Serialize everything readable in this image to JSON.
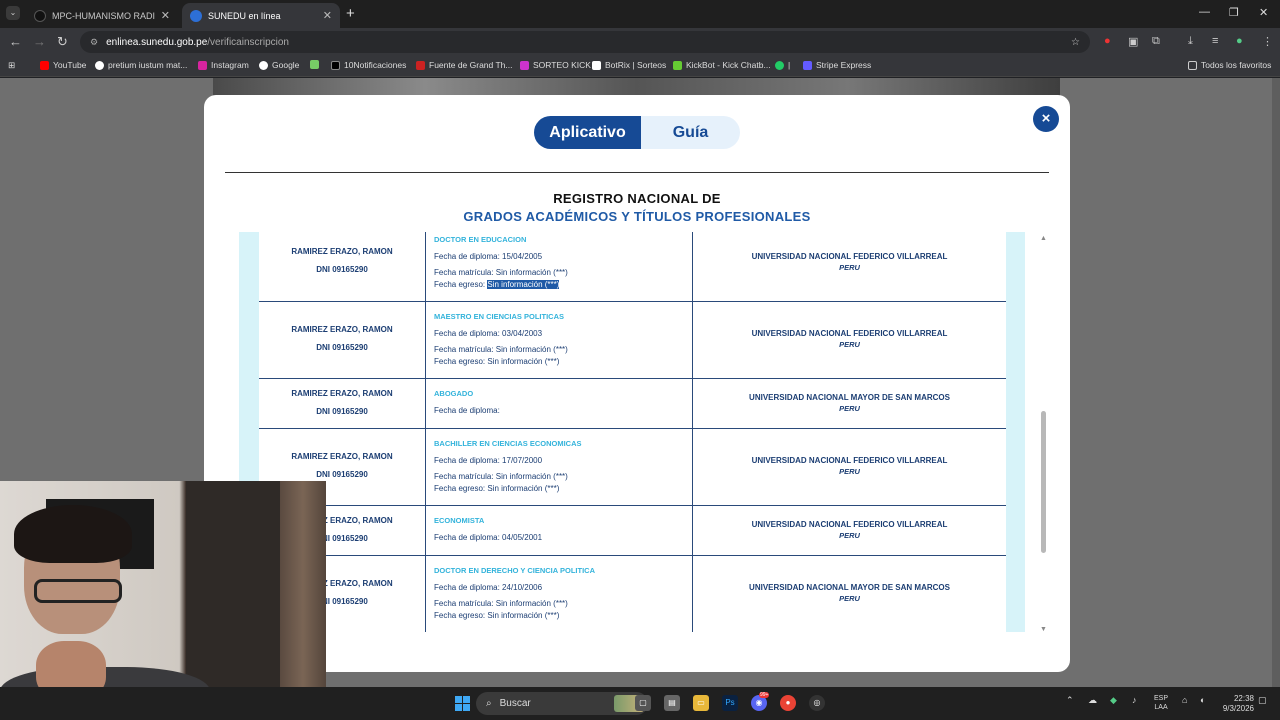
{
  "browser": {
    "tabs": [
      {
        "title": "MPC-HUMANISMO RADICAL (E",
        "active": false
      },
      {
        "title": "SUNEDU en línea",
        "active": true
      }
    ],
    "new_tab": "+",
    "url_site": "enlinea.sunedu.gob.pe",
    "url_path": "/verificainscripcion",
    "bookmarks": [
      "YouTube",
      "pretium iustum mat...",
      "Instagram",
      "Google",
      "10Notificaciones",
      "Fuente de Grand Th...",
      "SORTEO KICK",
      "BotRix | Sorteos",
      "KickBot - Kick Chatb...",
      "|",
      "Stripe Express"
    ],
    "all_bookmarks": "Todos los favoritos"
  },
  "modal": {
    "toggle_app": "Aplicativo",
    "toggle_guide": "Guía",
    "close": "×",
    "title_line1": "REGISTRO NACIONAL DE",
    "title_line2": "GRADOS ACADÉMICOS Y TÍTULOS PROFESIONALES",
    "rows": [
      {
        "name": "RAMIREZ ERAZO, RAMON",
        "dni": "DNI 09165290",
        "degree": "DOCTOR EN EDUCACION",
        "diploma": "Fecha de diploma: 15/04/2005",
        "matricula": "Fecha matrícula: Sin información (***)",
        "egreso_label": "Fecha egreso: ",
        "egreso_value": "Sin información (***)",
        "university": "UNIVERSIDAD NACIONAL FEDERICO VILLARREAL",
        "country": "PERU"
      },
      {
        "name": "RAMIREZ ERAZO, RAMON",
        "dni": "DNI 09165290",
        "degree": "MAESTRO EN CIENCIAS POLITICAS",
        "diploma": "Fecha de diploma: 03/04/2003",
        "matricula": "Fecha matrícula: Sin información (***)",
        "egreso": "Fecha egreso: Sin información (***)",
        "university": "UNIVERSIDAD NACIONAL FEDERICO VILLARREAL",
        "country": "PERU"
      },
      {
        "name": "RAMIREZ ERAZO, RAMON",
        "dni": "DNI 09165290",
        "degree": "ABOGADO",
        "diploma": "Fecha de diploma:",
        "university": "UNIVERSIDAD NACIONAL MAYOR DE SAN MARCOS",
        "country": "PERU"
      },
      {
        "name": "RAMIREZ ERAZO, RAMON",
        "dni": "DNI 09165290",
        "degree": "BACHILLER EN CIENCIAS ECONOMICAS",
        "diploma": "Fecha de diploma: 17/07/2000",
        "matricula": "Fecha matrícula: Sin información (***)",
        "egreso": "Fecha egreso: Sin información (***)",
        "university": "UNIVERSIDAD NACIONAL FEDERICO VILLARREAL",
        "country": "PERU"
      },
      {
        "name": "RAMIREZ ERAZO, RAMON",
        "dni": "DNI 09165290",
        "degree": "ECONOMISTA",
        "diploma": "Fecha de diploma: 04/05/2001",
        "university": "UNIVERSIDAD NACIONAL FEDERICO VILLARREAL",
        "country": "PERU"
      },
      {
        "name": "RAMIREZ ERAZO, RAMON",
        "dni": "DNI 09165290",
        "degree": "DOCTOR EN DERECHO Y CIENCIA POLITICA",
        "diploma": "Fecha de diploma: 24/10/2006",
        "matricula": "Fecha matrícula: Sin información (***)",
        "egreso": "Fecha egreso: Sin información (***)",
        "university": "UNIVERSIDAD NACIONAL MAYOR DE SAN MARCOS",
        "country": "PERU"
      }
    ]
  },
  "taskbar": {
    "search_label": "Buscar",
    "notif_badge": "99+",
    "lang_line1": "ESP",
    "lang_line2": "LAA",
    "time": "22:38",
    "date": "9/3/2026"
  },
  "colors": {
    "accent": "#164a95",
    "degree": "#33b3db",
    "text": "#1c3e73"
  }
}
